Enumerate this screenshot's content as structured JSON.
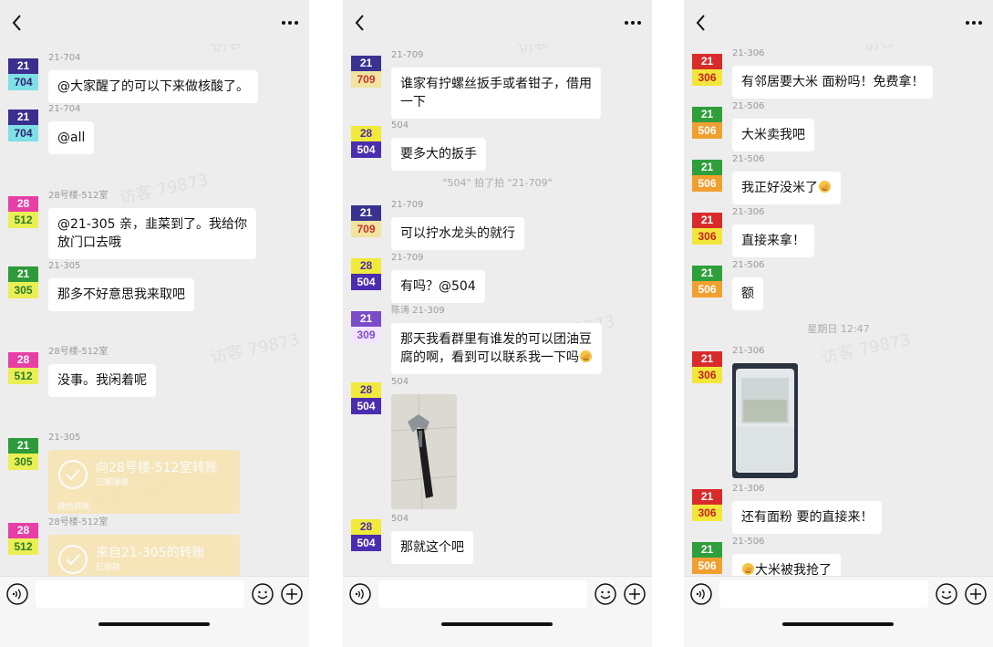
{
  "app": {
    "watermark": "访客 79873"
  },
  "screens": [
    {
      "messages": [
        {
          "sender": "21-704",
          "avatar_top": "21",
          "avatar_num": "704",
          "text": "@大家醒了的可以下来做核酸了。"
        },
        {
          "sender": "21-704",
          "avatar_top": "21",
          "avatar_num": "704",
          "text": "@all"
        },
        {
          "sender": "28号楼-512室",
          "avatar_top": "28",
          "avatar_num": "512",
          "text": "@21-305 亲，韭菜到了。我给你\n放门口去哦"
        },
        {
          "sender": "21-305",
          "avatar_top": "21",
          "avatar_num": "305",
          "text": "那多不好意思我来取吧"
        },
        {
          "sender": "28号楼-512室",
          "avatar_top": "28",
          "avatar_num": "512",
          "text": "没事。我闲着呢"
        },
        {
          "sender": "21-305",
          "avatar_top": "21",
          "avatar_num": "305",
          "transfer_title": "向28号楼-512室转账",
          "transfer_status": "已被接收",
          "transfer_foot": "微信转账"
        },
        {
          "sender": "28号楼-512室",
          "avatar_top": "28",
          "avatar_num": "512",
          "transfer_title": "来自21-305的转账",
          "transfer_status": "已收款"
        }
      ]
    },
    {
      "messages": [
        {
          "sender": "21-709",
          "avatar_top": "21",
          "avatar_num": "709",
          "text": "谁家有拧螺丝扳手或者钳子，借用\n一下"
        },
        {
          "sender": "504",
          "avatar_top": "28",
          "avatar_num": "504",
          "text": "要多大的扳手"
        },
        {
          "system": "\"504\" 拍了拍 \"21-709\""
        },
        {
          "sender": "21-709",
          "avatar_top": "21",
          "avatar_num": "709",
          "text": "可以拧水龙头的就行"
        },
        {
          "sender": "21-709",
          "avatar_top": "28",
          "avatar_num": "504",
          "text": "有吗？@504"
        },
        {
          "sender": "陈涛 21-309",
          "avatar_top": "21",
          "avatar_num": "309",
          "text": "那天我看群里有谁发的可以团油豆\n腐的啊，看到可以联系我一下吗"
        },
        {
          "sender": "504",
          "avatar_top": "28",
          "avatar_num": "504",
          "photo": "wrench"
        },
        {
          "sender": "504",
          "avatar_top": "28",
          "avatar_num": "504",
          "text": "那就这个吧"
        }
      ]
    },
    {
      "messages": [
        {
          "sender": "21-306",
          "avatar_top": "21",
          "avatar_num": "306",
          "text": "有邻居要大米 面粉吗！免费拿！"
        },
        {
          "sender": "21-506",
          "avatar_top": "21",
          "avatar_num": "506",
          "text": "大米卖我吧"
        },
        {
          "sender": "21-506",
          "avatar_top": "21",
          "avatar_num": "506",
          "text": "我正好没米了"
        },
        {
          "sender": "21-306",
          "avatar_top": "21",
          "avatar_num": "306",
          "text": "直接来拿！"
        },
        {
          "sender": "21-506",
          "avatar_top": "21",
          "avatar_num": "506",
          "text": "额"
        },
        {
          "system": "星期日 12:47"
        },
        {
          "sender": "21-306",
          "avatar_top": "21",
          "avatar_num": "306",
          "photo": "container"
        },
        {
          "sender": "21-306",
          "avatar_top": "21",
          "avatar_num": "306",
          "text": "还有面粉 要的直接来！"
        },
        {
          "sender": "21-506",
          "avatar_top": "21",
          "avatar_num": "506",
          "text": "大米被我抢了"
        }
      ]
    }
  ],
  "colors": {
    "unit_704": {
      "top": "#3a2e8f",
      "bottom_bg": "#7fe0e6",
      "bottom_fg": "#2b2370"
    },
    "unit_512": {
      "top": "#e83fa6",
      "bottom_bg": "#e9ef54",
      "bottom_fg": "#2d7a2a"
    },
    "unit_305": {
      "top": "#2e9b3a",
      "bottom_bg": "#e9ef54",
      "bottom_fg": "#2a7a2a"
    },
    "unit_709": {
      "top": "#3a3290",
      "bottom_bg": "#f0e4a0",
      "bottom_fg": "#c9302c"
    },
    "unit_504": {
      "top": "#f2ea3a",
      "bottom_bg": "#4b2db0",
      "bottom_fg": "#ffffff",
      "top_fg": "#4b2db0"
    },
    "unit_309": {
      "top": "#7b4cc9",
      "bottom_bg": "#f3e4ff",
      "bottom_fg": "#7b4cc9"
    },
    "unit_306": {
      "top": "#d92b2b",
      "bottom_bg": "#f2e63a",
      "bottom_fg": "#c62020"
    },
    "unit_506": {
      "top": "#2f9f3c",
      "bottom_bg": "#f0a030",
      "bottom_fg": "#ffffff"
    }
  }
}
